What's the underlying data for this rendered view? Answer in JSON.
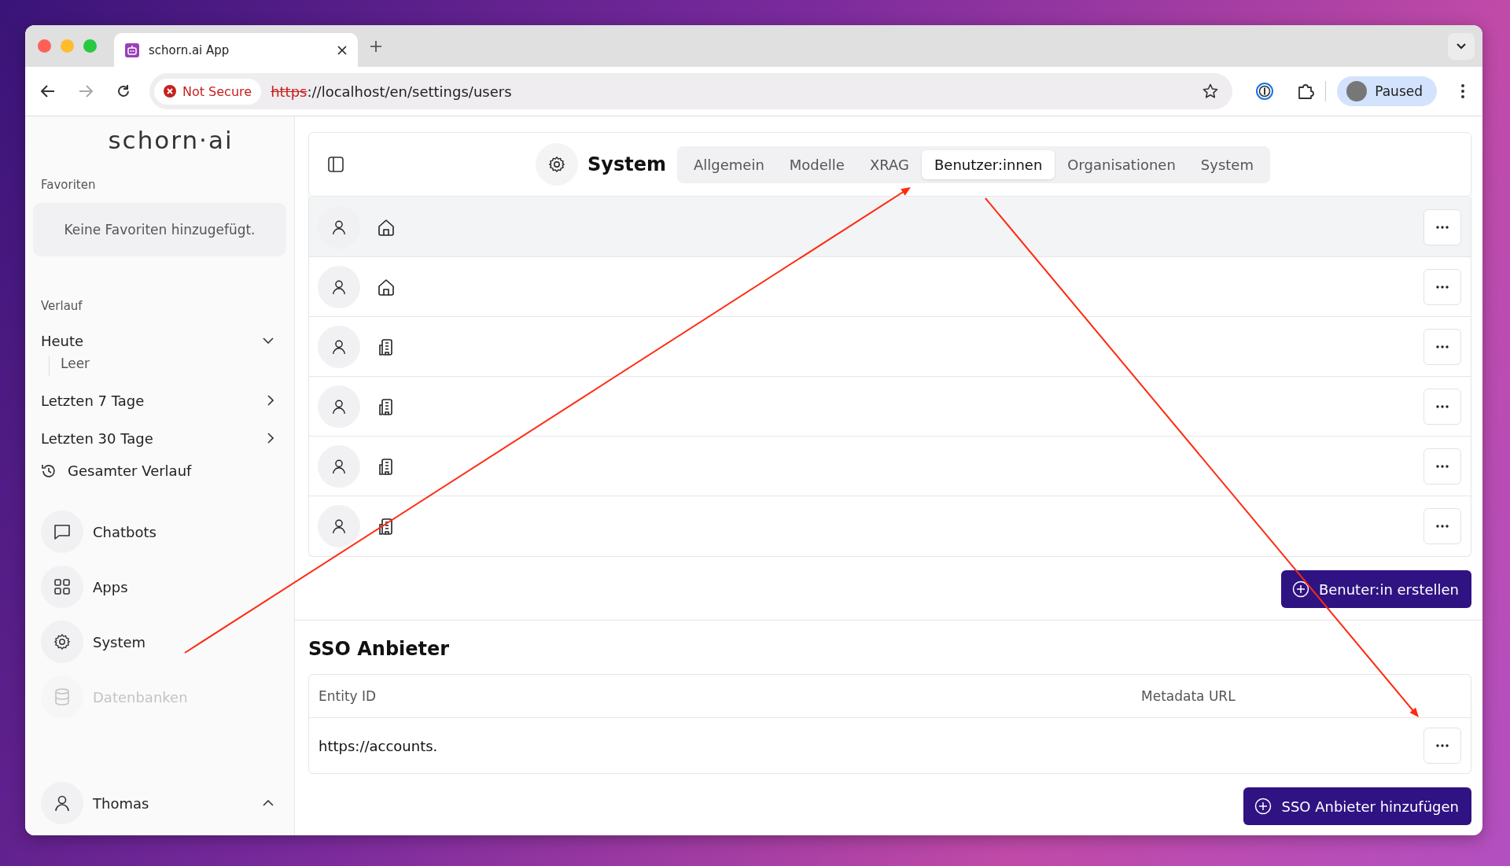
{
  "browser": {
    "tab_title": "schorn.ai App",
    "security_label": "Not Secure",
    "url_scheme": "https",
    "url_rest": "://localhost/en/settings/users",
    "profile_label": "Paused"
  },
  "sidebar": {
    "logo": "schorn·ai",
    "favorites_heading": "Favoriten",
    "favorites_empty": "Keine Favoriten hinzugefügt.",
    "history_heading": "Verlauf",
    "history_groups": [
      {
        "label": "Heute",
        "expanded": true,
        "children": [
          {
            "label": "Leer"
          }
        ]
      },
      {
        "label": "Letzten 7 Tage",
        "expanded": false
      },
      {
        "label": "Letzten 30 Tage",
        "expanded": false
      }
    ],
    "all_history": "Gesamter Verlauf",
    "nav": [
      {
        "label": "Chatbots",
        "kind": "chat",
        "disabled": false
      },
      {
        "label": "Apps",
        "kind": "apps",
        "disabled": false
      },
      {
        "label": "System",
        "kind": "settings",
        "disabled": false
      },
      {
        "label": "Datenbanken",
        "kind": "database",
        "disabled": true
      }
    ],
    "user": {
      "name": "Thomas",
      "expanded": true
    }
  },
  "header": {
    "title": "System",
    "tabs": [
      {
        "label": "Allgemein",
        "selected": false
      },
      {
        "label": "Modelle",
        "selected": false
      },
      {
        "label": "XRAG",
        "selected": false
      },
      {
        "label": "Benutzer:innen",
        "selected": true
      },
      {
        "label": "Organisationen",
        "selected": false
      },
      {
        "label": "System",
        "selected": false
      }
    ]
  },
  "users": {
    "rows": [
      {
        "kind": "home",
        "selected": true
      },
      {
        "kind": "home",
        "selected": false
      },
      {
        "kind": "organization",
        "selected": false
      },
      {
        "kind": "organization",
        "selected": false
      },
      {
        "kind": "organization",
        "selected": false
      },
      {
        "kind": "organization",
        "selected": false
      }
    ],
    "create_button": "Benuter:in erstellen"
  },
  "sso": {
    "title": "SSO Anbieter",
    "columns": [
      "Entity ID",
      "Metadata URL"
    ],
    "rows": [
      {
        "entity_id": "https://accounts."
      }
    ],
    "add_button": "SSO Anbieter hinzufügen"
  }
}
